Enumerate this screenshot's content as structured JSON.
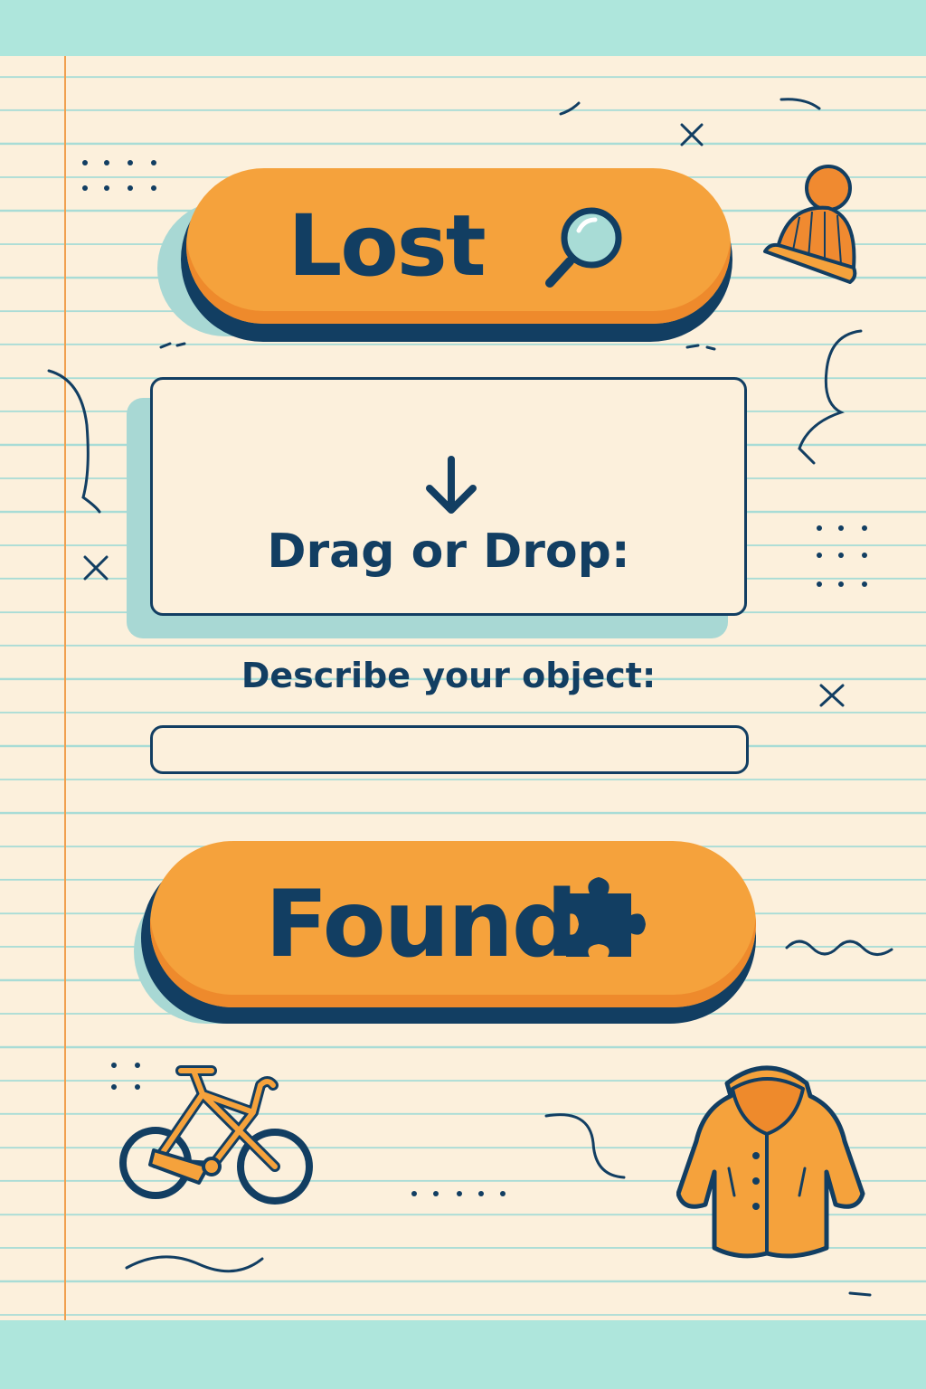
{
  "buttons": {
    "lost_label": "Lost",
    "found_label": "Found"
  },
  "dropzone": {
    "label": "Drag or Drop:"
  },
  "description": {
    "label": "Describe your object:",
    "value": "",
    "placeholder": ""
  },
  "colors": {
    "paper": "#fcf0dc",
    "band": "#aee6dc",
    "orange": "#f5a23c",
    "navy": "#123e62",
    "shadow": "#a8d8d4"
  },
  "icons": [
    "magnifying-glass-icon",
    "puzzle-piece-icon",
    "down-arrow-icon",
    "beanie-hat-icon",
    "bicycle-icon",
    "raincoat-icon"
  ]
}
